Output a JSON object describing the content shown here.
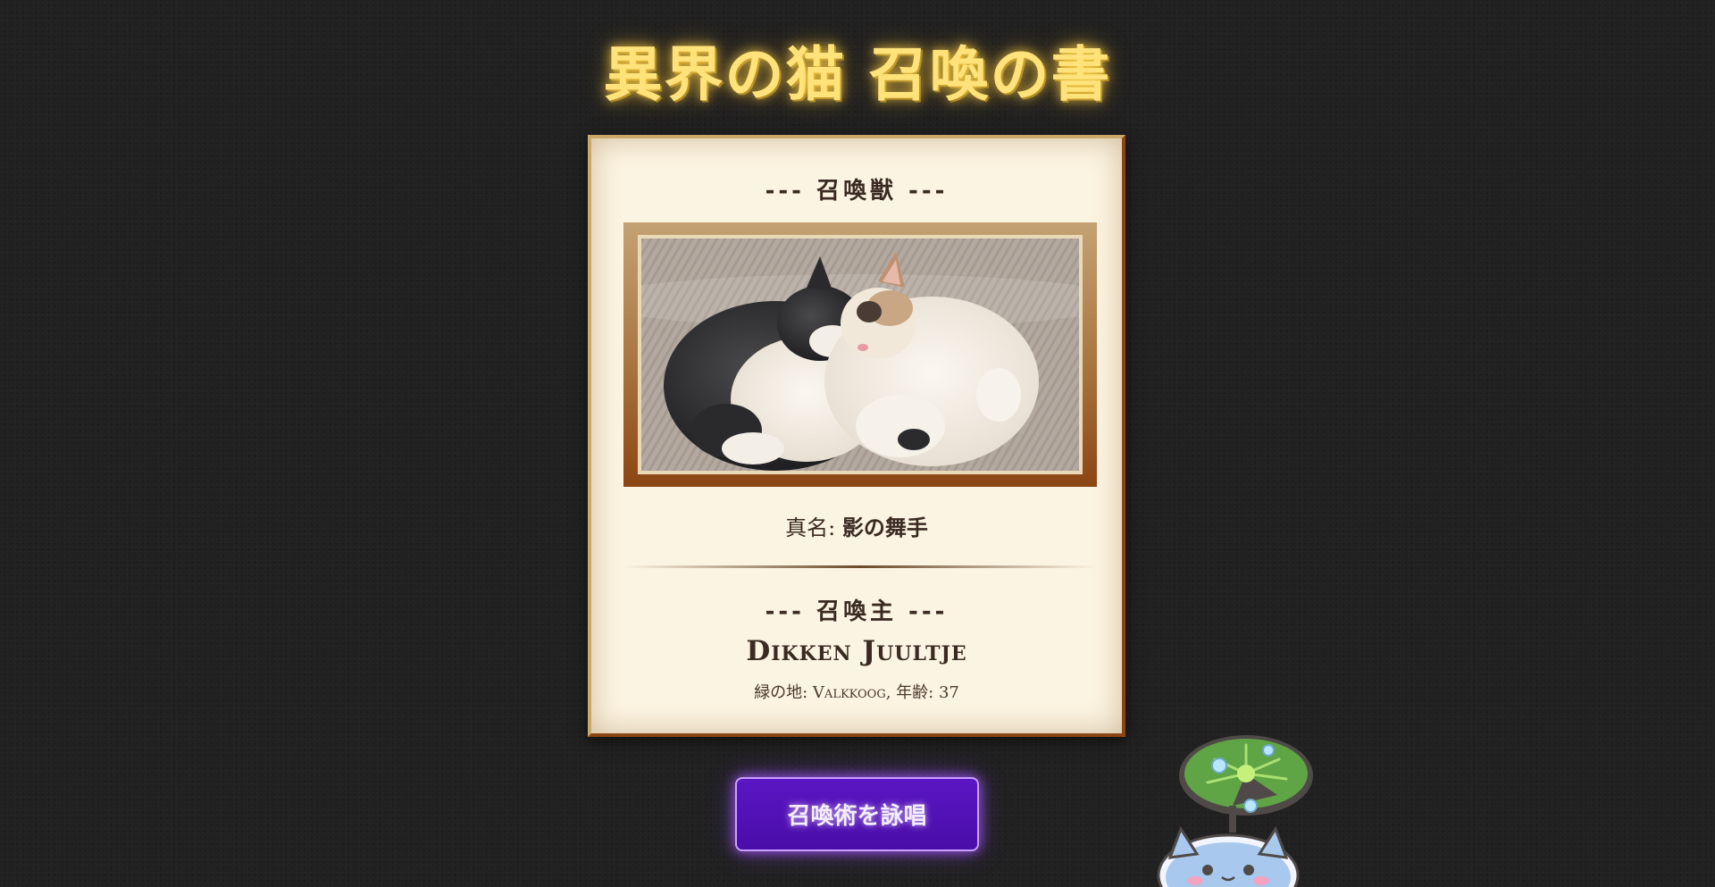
{
  "page": {
    "title": "異界の猫 召喚の書"
  },
  "card": {
    "creature_heading": "--- 召喚獣 ---",
    "image_alt": "cat-photo",
    "true_name_label": "真名:",
    "true_name_value": "影の舞手",
    "summoner_heading": "--- 召喚主 ---",
    "summoner_name": "Dikken Juultje",
    "summoner_meta": "緑の地: Valkkoog, 年齢: 37"
  },
  "actions": {
    "summon_label": "召喚術を詠唱"
  },
  "colors": {
    "background": "#212121",
    "title": "#ffe27a",
    "card": "#fcf4e2",
    "frame": "#8b4513",
    "button": "#4a0da8"
  },
  "icons": {
    "mascot": "frog-lily-pad-icon"
  }
}
